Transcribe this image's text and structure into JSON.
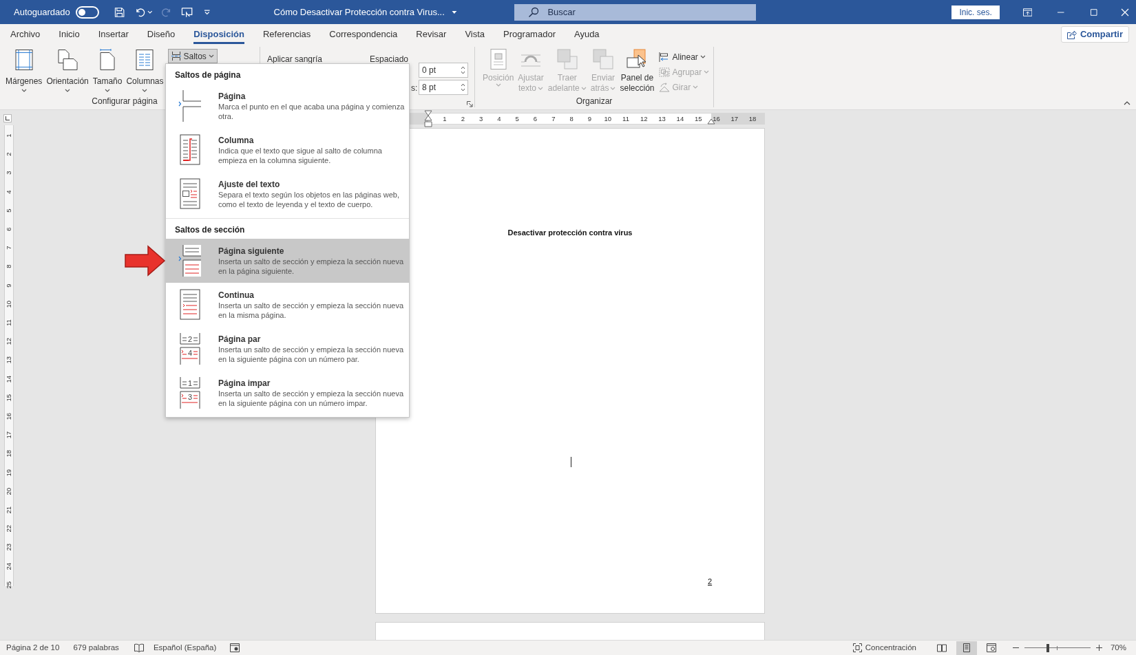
{
  "title_bar": {
    "autosave_label": "Autoguardado",
    "autosave_on": false,
    "document_title": "Cómo Desactivar Protección contra Virus...",
    "search_placeholder": "Buscar",
    "sign_in": "Inic. ses."
  },
  "tabs": [
    {
      "label": "Archivo",
      "selected": false
    },
    {
      "label": "Inicio",
      "selected": false
    },
    {
      "label": "Insertar",
      "selected": false
    },
    {
      "label": "Diseño",
      "selected": false
    },
    {
      "label": "Disposición",
      "selected": true
    },
    {
      "label": "Referencias",
      "selected": false
    },
    {
      "label": "Correspondencia",
      "selected": false
    },
    {
      "label": "Revisar",
      "selected": false
    },
    {
      "label": "Vista",
      "selected": false
    },
    {
      "label": "Programador",
      "selected": false
    },
    {
      "label": "Ayuda",
      "selected": false
    }
  ],
  "share_button": "Compartir",
  "ribbon": {
    "page_setup": {
      "buttons": [
        {
          "kind": "margins",
          "label": "Márgenes"
        },
        {
          "kind": "orientation",
          "label": "Orientación"
        },
        {
          "kind": "size",
          "label": "Tamaño"
        },
        {
          "kind": "columns",
          "label": "Columnas"
        }
      ],
      "breaks_button": {
        "label": "Saltos",
        "pressed": true
      },
      "group_label": "Configurar página"
    },
    "paragraph": {
      "indent_label": "Aplicar sangría",
      "spacing_label": "Espaciado",
      "spacing_after_label": "s:",
      "spacing_before": "0 pt",
      "spacing_after": "8 pt"
    },
    "arrange": {
      "buttons": [
        {
          "kind": "position",
          "lines": [
            "Posición"
          ],
          "dropdown": true,
          "disabled": true
        },
        {
          "kind": "wrap",
          "lines": [
            "Ajustar",
            "texto"
          ],
          "dropdown": true,
          "disabled": true
        },
        {
          "kind": "forward",
          "lines": [
            "Traer",
            "adelante"
          ],
          "dropdown": true,
          "disabled": true
        },
        {
          "kind": "backward",
          "lines": [
            "Enviar",
            "atrás"
          ],
          "dropdown": true,
          "disabled": true
        },
        {
          "kind": "selection_pane",
          "lines": [
            "Panel de",
            "selección"
          ],
          "dropdown": false,
          "disabled": false
        }
      ],
      "small_buttons": [
        {
          "kind": "align",
          "label": "Alinear",
          "disabled": false
        },
        {
          "kind": "group",
          "label": "Agrupar",
          "disabled": true
        },
        {
          "kind": "rotate",
          "label": "Girar",
          "disabled": true
        }
      ],
      "group_label": "Organizar"
    }
  },
  "breaks_menu": {
    "sections": [
      {
        "heading": "Saltos de página",
        "items": [
          {
            "kind": "page",
            "title": "Página",
            "description": "Marca el punto en el que acaba una página y comienza otra.",
            "selected": false
          },
          {
            "kind": "column",
            "title": "Columna",
            "description": "Indica que el texto que sigue al salto de columna empieza en la columna siguiente.",
            "selected": false
          },
          {
            "kind": "text_wrap",
            "title": "Ajuste del texto",
            "description": "Separa el texto según los objetos en las páginas web, como el texto de leyenda y el texto de cuerpo.",
            "selected": false
          }
        ]
      },
      {
        "heading": "Saltos de sección",
        "items": [
          {
            "kind": "next_page",
            "title": "Página siguiente",
            "description": "Inserta un salto de sección y empieza la sección nueva en la página siguiente.",
            "selected": true
          },
          {
            "kind": "continuous",
            "title": "Continua",
            "description": "Inserta un salto de sección y empieza la sección nueva en la misma página.",
            "selected": false
          },
          {
            "kind": "even_page",
            "title": "Página par",
            "description": "Inserta un salto de sección y empieza la sección nueva en la siguiente página con un número par.",
            "selected": false,
            "icon_labels": [
              "2",
              "4"
            ]
          },
          {
            "kind": "odd_page",
            "title": "Página impar",
            "description": "Inserta un salto de sección y empieza la sección nueva en la siguiente página con un número impar.",
            "selected": false,
            "icon_labels": [
              "1",
              "3"
            ]
          }
        ]
      }
    ]
  },
  "ruler": {
    "horizontal": [
      "1",
      "2",
      "3",
      "4",
      "5",
      "6",
      "7",
      "8",
      "9",
      "10",
      "11",
      "12",
      "13",
      "14",
      "15",
      "16",
      "17",
      "18"
    ],
    "vertical": [
      "1",
      "2",
      "3",
      "4",
      "5",
      "6",
      "7",
      "8",
      "9",
      "10",
      "11",
      "12",
      "13",
      "14",
      "15",
      "16",
      "17",
      "18",
      "19",
      "20",
      "21",
      "22",
      "23",
      "24",
      "25"
    ]
  },
  "document": {
    "heading": "Desactivar protección contra virus",
    "page_number": "2"
  },
  "status_bar": {
    "page": "Página 2 de 10",
    "words": "679 palabras",
    "language": "Español (España)",
    "focus": "Concentración",
    "views": [
      {
        "kind": "read",
        "selected": false
      },
      {
        "kind": "print",
        "selected": true
      },
      {
        "kind": "web",
        "selected": false
      }
    ],
    "zoom": {
      "level": 0.35,
      "label": "70%"
    }
  }
}
